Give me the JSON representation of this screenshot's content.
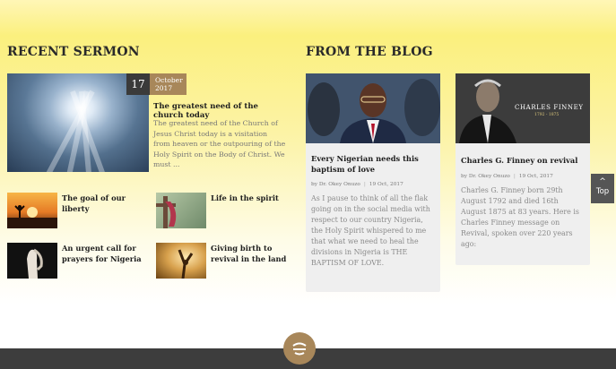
{
  "recent_sermon": {
    "heading": "RECENT SERMON",
    "featured": {
      "day": "17",
      "month": "October",
      "year": "2017",
      "title": "The greatest need of the church today",
      "excerpt": "The greatest need of the Church of Jesus Christ today is a visitation from heaven or the outpouring of the Holy Spirit on the Body of Christ. We must ..."
    },
    "items": [
      {
        "title": "The goal of our liberty",
        "icon": "sunset-figure-image"
      },
      {
        "title": "Life in the spirit",
        "icon": "cross-image"
      },
      {
        "title": "An urgent call for prayers for Nigeria",
        "icon": "praying-hands-image"
      },
      {
        "title": "Giving birth to revival in the land",
        "icon": "worship-image"
      }
    ]
  },
  "blog": {
    "heading": "FROM THE BLOG",
    "posts": [
      {
        "title": "Every Nigerian needs this baptism of love",
        "author": "by  Dr. Okey Onuzo",
        "date": "19 Oct, 2017",
        "excerpt": "As I pause to think of all the flak going on in the social media with respect to our country Nigeria, the Holy Spirit whispered to me that what we need to heal the divisions in Nigeria is THE BAPTISM OF LOVE."
      },
      {
        "title": "Charles G. Finney on revival",
        "author": "by  Dr. Okey Onuzo",
        "date": "19 Oct, 2017",
        "image_caption": "CHARLES FINNEY",
        "image_subcaption": "1792 - 1875",
        "excerpt": "Charles G. Finney born 29th August 1792 and died 16th August 1875 at 83 years. Here is Charles Finney message on Revival, spoken over 220 years ago:"
      }
    ]
  },
  "back_to_top": {
    "label": "Top"
  },
  "colors": {
    "accent": "#a8875a",
    "dark": "#3a3a3a",
    "yellow": "#fbf07e"
  }
}
